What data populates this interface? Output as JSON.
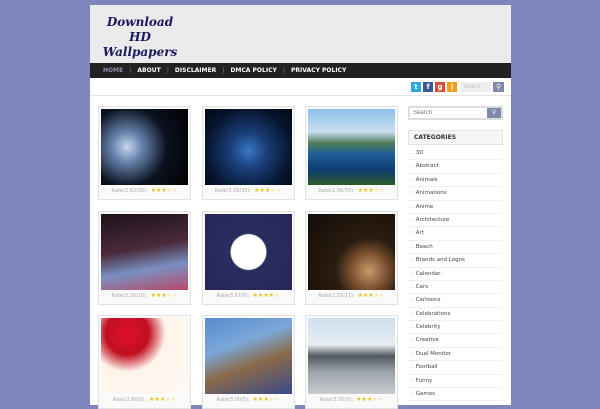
{
  "site": {
    "title_line1": "Download HD",
    "title_line2": "Wallpapers"
  },
  "nav": [
    {
      "label": "HOME",
      "active": true
    },
    {
      "label": "ABOUT"
    },
    {
      "label": "DISCLAIMER"
    },
    {
      "label": "DMCA POLICY"
    },
    {
      "label": "PRIVACY POLICY"
    }
  ],
  "topbar": {
    "search_placeholder": "SEARCH",
    "social": [
      {
        "name": "twitter",
        "color": "#2aa9e0"
      },
      {
        "name": "facebook",
        "color": "#3b5998"
      },
      {
        "name": "google-plus",
        "color": "#d84b3c"
      },
      {
        "name": "rss",
        "color": "#f39c1e"
      }
    ]
  },
  "wallpapers": [
    {
      "rate": "Rate(2.63/30):",
      "stars": 3,
      "bg": "radial-gradient(circle at 30% 50%,#c8d8ee 0,#6a86b0 20%,#0b1220 55%,#000 100%)"
    },
    {
      "rate": "Rate(3.09/35):",
      "stars": 3,
      "bg": "radial-gradient(circle at 50% 55%,#3a78c8 0,#1a3e78 30%,#06152e 70%,#020814 100%)"
    },
    {
      "rate": "Rate(2.96/70):",
      "stars": 3,
      "bg": "linear-gradient(180deg,#8fc0ea 0,#c9def0 30%,#4f7d5a 45%,#1d5d9a 60%,#0e3d70 80%,#2e5a2c 100%)"
    },
    {
      "rate": "Rate(3.20/10):",
      "stars": 3,
      "bg": "linear-gradient(170deg,#1c1218 0,#4a2a3a 45%,#7a90c0 70%,#b84a6a 100%)"
    },
    {
      "rate": "Rate(3.67/6):",
      "stars": 4,
      "bg": "radial-gradient(circle at 50% 50%,#fff 0,#fff 30%,#2a2d5e 32%,#232656 100%)"
    },
    {
      "rate": "Rate(2.55/11):",
      "stars": 3,
      "bg": "radial-gradient(circle at 70% 75%,#c89a6a 0,#7a5030 22%,#2a1c10 40%,#120c08 100%)"
    },
    {
      "rate": "Rate(2.80/5):",
      "stars": 3,
      "bg": "radial-gradient(circle at 30% 20%,#e0102a 0,#c01020 25%,#fff4ec 45%,#fffaf2 100%)"
    },
    {
      "rate": "Rate(3.00/5):",
      "stars": 3,
      "bg": "linear-gradient(160deg,#5a8ad0 0,#7aa8d8 35%,#8a6a4a 60%,#3a4a8a 100%)"
    },
    {
      "rate": "Rate(3.00/5):",
      "stars": 3,
      "bg": "linear-gradient(180deg,#cfe0ee 0,#e8eef2 35%,#505860 50%,#9aa2a8 70%,#c8ccd0 100%)"
    }
  ],
  "sidebar": {
    "search_placeholder": "Search",
    "categories_title": "CATEGORIES",
    "categories": [
      "3D",
      "Abstract",
      "Animals",
      "Animations",
      "Anime",
      "Architecture",
      "Art",
      "Beach",
      "Brands and Logos",
      "Calendar",
      "Cars",
      "Cartoons",
      "Celebrations",
      "Celebrity",
      "Creative",
      "Dual Monitor",
      "Football",
      "Funny",
      "Games"
    ]
  }
}
